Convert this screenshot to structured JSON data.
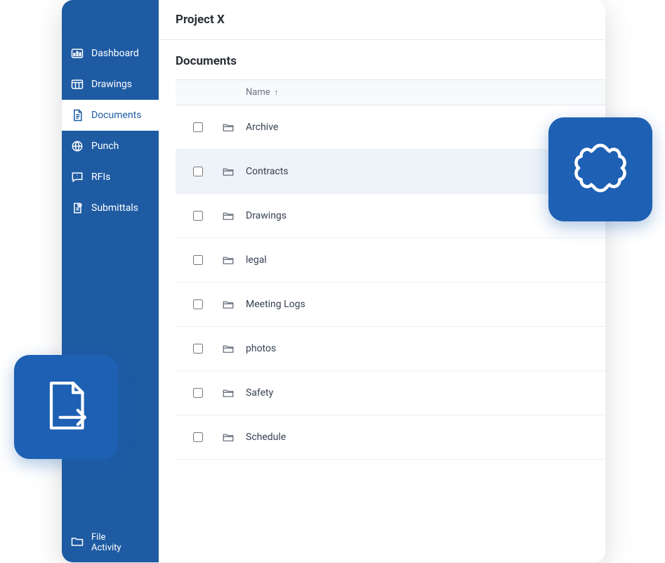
{
  "header": {
    "title": "Project X"
  },
  "section": {
    "title": "Documents"
  },
  "sidebar": {
    "items": [
      {
        "label": "Dashboard"
      },
      {
        "label": "Drawings"
      },
      {
        "label": "Documents"
      },
      {
        "label": "Punch"
      },
      {
        "label": "RFIs"
      },
      {
        "label": "Submittals"
      }
    ],
    "bottom": {
      "label": "File\nActivity"
    }
  },
  "table": {
    "header": {
      "name": "Name"
    },
    "rows": [
      {
        "name": "Archive"
      },
      {
        "name": "Contracts"
      },
      {
        "name": "Drawings"
      },
      {
        "name": "legal"
      },
      {
        "name": "Meeting Logs"
      },
      {
        "name": "photos"
      },
      {
        "name": "Safety"
      },
      {
        "name": "Schedule"
      }
    ]
  }
}
